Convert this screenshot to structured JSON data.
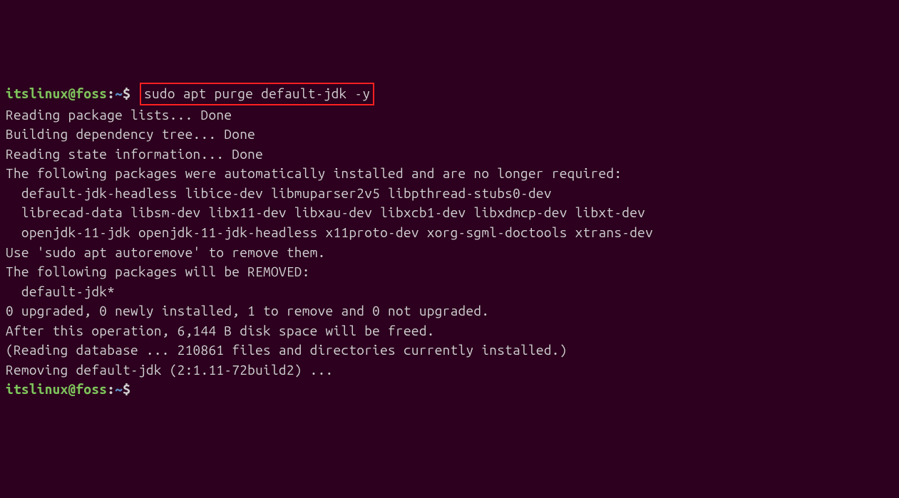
{
  "prompt1": {
    "user": "itslinux@foss",
    "colon": ":",
    "tilde": "~",
    "dollar": "$ "
  },
  "command": "sudo apt purge default-jdk -y",
  "output": {
    "l1": "Reading package lists... Done",
    "l2": "Building dependency tree... Done",
    "l3": "Reading state information... Done",
    "l4": "The following packages were automatically installed and are no longer required:",
    "l5": "  default-jdk-headless libice-dev libmuparser2v5 libpthread-stubs0-dev",
    "l6": "  librecad-data libsm-dev libx11-dev libxau-dev libxcb1-dev libxdmcp-dev libxt-dev",
    "l7": "  openjdk-11-jdk openjdk-11-jdk-headless x11proto-dev xorg-sgml-doctools xtrans-dev",
    "l8": "Use 'sudo apt autoremove' to remove them.",
    "l9": "The following packages will be REMOVED:",
    "l10": "  default-jdk*",
    "l11": "0 upgraded, 0 newly installed, 1 to remove and 0 not upgraded.",
    "l12": "After this operation, 6,144 B disk space will be freed.",
    "l13": "(Reading database ... 210861 files and directories currently installed.)",
    "l14": "Removing default-jdk (2:1.11-72build2) ..."
  },
  "prompt2": {
    "user": "itslinux@foss",
    "colon": ":",
    "tilde": "~",
    "dollar": "$"
  }
}
